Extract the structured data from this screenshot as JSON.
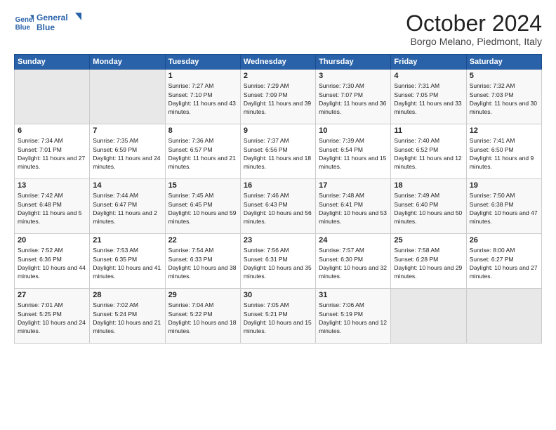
{
  "header": {
    "logo_line1": "General",
    "logo_line2": "Blue",
    "title": "October 2024",
    "location": "Borgo Melano, Piedmont, Italy"
  },
  "weekdays": [
    "Sunday",
    "Monday",
    "Tuesday",
    "Wednesday",
    "Thursday",
    "Friday",
    "Saturday"
  ],
  "weeks": [
    [
      {
        "day": "",
        "empty": true
      },
      {
        "day": "",
        "empty": true
      },
      {
        "day": "1",
        "sunrise": "Sunrise: 7:27 AM",
        "sunset": "Sunset: 7:10 PM",
        "daylight": "Daylight: 11 hours and 43 minutes."
      },
      {
        "day": "2",
        "sunrise": "Sunrise: 7:29 AM",
        "sunset": "Sunset: 7:09 PM",
        "daylight": "Daylight: 11 hours and 39 minutes."
      },
      {
        "day": "3",
        "sunrise": "Sunrise: 7:30 AM",
        "sunset": "Sunset: 7:07 PM",
        "daylight": "Daylight: 11 hours and 36 minutes."
      },
      {
        "day": "4",
        "sunrise": "Sunrise: 7:31 AM",
        "sunset": "Sunset: 7:05 PM",
        "daylight": "Daylight: 11 hours and 33 minutes."
      },
      {
        "day": "5",
        "sunrise": "Sunrise: 7:32 AM",
        "sunset": "Sunset: 7:03 PM",
        "daylight": "Daylight: 11 hours and 30 minutes."
      }
    ],
    [
      {
        "day": "6",
        "sunrise": "Sunrise: 7:34 AM",
        "sunset": "Sunset: 7:01 PM",
        "daylight": "Daylight: 11 hours and 27 minutes."
      },
      {
        "day": "7",
        "sunrise": "Sunrise: 7:35 AM",
        "sunset": "Sunset: 6:59 PM",
        "daylight": "Daylight: 11 hours and 24 minutes."
      },
      {
        "day": "8",
        "sunrise": "Sunrise: 7:36 AM",
        "sunset": "Sunset: 6:57 PM",
        "daylight": "Daylight: 11 hours and 21 minutes."
      },
      {
        "day": "9",
        "sunrise": "Sunrise: 7:37 AM",
        "sunset": "Sunset: 6:56 PM",
        "daylight": "Daylight: 11 hours and 18 minutes."
      },
      {
        "day": "10",
        "sunrise": "Sunrise: 7:39 AM",
        "sunset": "Sunset: 6:54 PM",
        "daylight": "Daylight: 11 hours and 15 minutes."
      },
      {
        "day": "11",
        "sunrise": "Sunrise: 7:40 AM",
        "sunset": "Sunset: 6:52 PM",
        "daylight": "Daylight: 11 hours and 12 minutes."
      },
      {
        "day": "12",
        "sunrise": "Sunrise: 7:41 AM",
        "sunset": "Sunset: 6:50 PM",
        "daylight": "Daylight: 11 hours and 9 minutes."
      }
    ],
    [
      {
        "day": "13",
        "sunrise": "Sunrise: 7:42 AM",
        "sunset": "Sunset: 6:48 PM",
        "daylight": "Daylight: 11 hours and 5 minutes."
      },
      {
        "day": "14",
        "sunrise": "Sunrise: 7:44 AM",
        "sunset": "Sunset: 6:47 PM",
        "daylight": "Daylight: 11 hours and 2 minutes."
      },
      {
        "day": "15",
        "sunrise": "Sunrise: 7:45 AM",
        "sunset": "Sunset: 6:45 PM",
        "daylight": "Daylight: 10 hours and 59 minutes."
      },
      {
        "day": "16",
        "sunrise": "Sunrise: 7:46 AM",
        "sunset": "Sunset: 6:43 PM",
        "daylight": "Daylight: 10 hours and 56 minutes."
      },
      {
        "day": "17",
        "sunrise": "Sunrise: 7:48 AM",
        "sunset": "Sunset: 6:41 PM",
        "daylight": "Daylight: 10 hours and 53 minutes."
      },
      {
        "day": "18",
        "sunrise": "Sunrise: 7:49 AM",
        "sunset": "Sunset: 6:40 PM",
        "daylight": "Daylight: 10 hours and 50 minutes."
      },
      {
        "day": "19",
        "sunrise": "Sunrise: 7:50 AM",
        "sunset": "Sunset: 6:38 PM",
        "daylight": "Daylight: 10 hours and 47 minutes."
      }
    ],
    [
      {
        "day": "20",
        "sunrise": "Sunrise: 7:52 AM",
        "sunset": "Sunset: 6:36 PM",
        "daylight": "Daylight: 10 hours and 44 minutes."
      },
      {
        "day": "21",
        "sunrise": "Sunrise: 7:53 AM",
        "sunset": "Sunset: 6:35 PM",
        "daylight": "Daylight: 10 hours and 41 minutes."
      },
      {
        "day": "22",
        "sunrise": "Sunrise: 7:54 AM",
        "sunset": "Sunset: 6:33 PM",
        "daylight": "Daylight: 10 hours and 38 minutes."
      },
      {
        "day": "23",
        "sunrise": "Sunrise: 7:56 AM",
        "sunset": "Sunset: 6:31 PM",
        "daylight": "Daylight: 10 hours and 35 minutes."
      },
      {
        "day": "24",
        "sunrise": "Sunrise: 7:57 AM",
        "sunset": "Sunset: 6:30 PM",
        "daylight": "Daylight: 10 hours and 32 minutes."
      },
      {
        "day": "25",
        "sunrise": "Sunrise: 7:58 AM",
        "sunset": "Sunset: 6:28 PM",
        "daylight": "Daylight: 10 hours and 29 minutes."
      },
      {
        "day": "26",
        "sunrise": "Sunrise: 8:00 AM",
        "sunset": "Sunset: 6:27 PM",
        "daylight": "Daylight: 10 hours and 27 minutes."
      }
    ],
    [
      {
        "day": "27",
        "sunrise": "Sunrise: 7:01 AM",
        "sunset": "Sunset: 5:25 PM",
        "daylight": "Daylight: 10 hours and 24 minutes."
      },
      {
        "day": "28",
        "sunrise": "Sunrise: 7:02 AM",
        "sunset": "Sunset: 5:24 PM",
        "daylight": "Daylight: 10 hours and 21 minutes."
      },
      {
        "day": "29",
        "sunrise": "Sunrise: 7:04 AM",
        "sunset": "Sunset: 5:22 PM",
        "daylight": "Daylight: 10 hours and 18 minutes."
      },
      {
        "day": "30",
        "sunrise": "Sunrise: 7:05 AM",
        "sunset": "Sunset: 5:21 PM",
        "daylight": "Daylight: 10 hours and 15 minutes."
      },
      {
        "day": "31",
        "sunrise": "Sunrise: 7:06 AM",
        "sunset": "Sunset: 5:19 PM",
        "daylight": "Daylight: 10 hours and 12 minutes."
      },
      {
        "day": "",
        "empty": true
      },
      {
        "day": "",
        "empty": true
      }
    ]
  ]
}
